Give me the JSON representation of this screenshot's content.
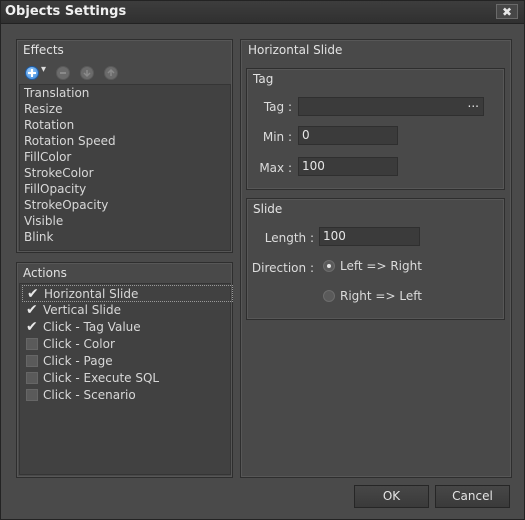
{
  "window": {
    "title": "Objects Settings",
    "close_label": "✖"
  },
  "effects": {
    "title": "Effects",
    "items": [
      "Translation",
      "Resize",
      "Rotation",
      "Rotation Speed",
      "FillColor",
      "StrokeColor",
      "FillOpacity",
      "StrokeOpacity",
      "Visible",
      "Blink"
    ],
    "toolbar": [
      "add-icon",
      "remove-icon",
      "move-down-icon",
      "move-up-icon"
    ],
    "add_dropdown_glyph": "▾"
  },
  "actions": {
    "title": "Actions",
    "items": [
      {
        "label": "Horizontal Slide",
        "checked": true,
        "check_glyph": "✔"
      },
      {
        "label": "Vertical Slide",
        "checked": true,
        "check_glyph": "✔"
      },
      {
        "label": "Click - Tag Value",
        "checked": true,
        "check_glyph": "✔"
      },
      {
        "label": "Click - Color",
        "checked": false,
        "check_glyph": ""
      },
      {
        "label": "Click - Page",
        "checked": false,
        "check_glyph": ""
      },
      {
        "label": "Click - Execute SQL",
        "checked": false,
        "check_glyph": ""
      },
      {
        "label": "Click - Scenario",
        "checked": false,
        "check_glyph": ""
      }
    ]
  },
  "detail": {
    "title": "Horizontal Slide",
    "tag_group": {
      "title": "Tag",
      "tag_label": "Tag :",
      "tag_value": "",
      "tag_browse": "...",
      "min_label": "Min :",
      "min_value": "0",
      "max_label": "Max :",
      "max_value": "100"
    },
    "slide_group": {
      "title": "Slide",
      "length_label": "Length :",
      "length_value": "100",
      "direction_label": "Direction :",
      "options": [
        {
          "label": "Left => Right",
          "selected": true
        },
        {
          "label": "Right => Left",
          "selected": false
        }
      ]
    }
  },
  "buttons": {
    "ok": "OK",
    "cancel": "Cancel"
  }
}
